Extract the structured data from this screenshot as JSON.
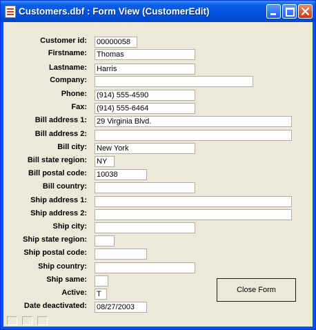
{
  "window": {
    "title": "Customers.dbf : Form View (CustomerEdit)",
    "icons": {
      "app": "document-icon",
      "minimize": "minimize-icon",
      "maximize": "maximize-icon",
      "close": "close-icon"
    }
  },
  "form": {
    "fields": [
      {
        "label": "Customer id:",
        "value": "00000058"
      },
      {
        "label": "Firstname:",
        "value": "Thomas"
      },
      {
        "label": "Lastname:",
        "value": "Harris"
      },
      {
        "label": "Company:",
        "value": ""
      },
      {
        "label": "Phone:",
        "value": "(914) 555-4590"
      },
      {
        "label": "Fax:",
        "value": "(914) 555-6464"
      },
      {
        "label": "Bill address 1:",
        "value": "29 Virginia Blvd."
      },
      {
        "label": "Bill address 2:",
        "value": ""
      },
      {
        "label": "Bill city:",
        "value": "New York"
      },
      {
        "label": "Bill state region:",
        "value": "NY"
      },
      {
        "label": "Bill postal code:",
        "value": "10038"
      },
      {
        "label": "Bill country:",
        "value": ""
      },
      {
        "label": "Ship address 1:",
        "value": ""
      },
      {
        "label": "Ship address 2:",
        "value": ""
      },
      {
        "label": "Ship city:",
        "value": ""
      },
      {
        "label": "Ship state region:",
        "value": ""
      },
      {
        "label": "Ship postal code:",
        "value": ""
      },
      {
        "label": "Ship country:",
        "value": ""
      },
      {
        "label": "Ship same:",
        "value": ""
      },
      {
        "label": "Active:",
        "value": "T"
      },
      {
        "label": "Date deactivated:",
        "value": "08/27/2003"
      }
    ],
    "close_button": "Close Form"
  }
}
